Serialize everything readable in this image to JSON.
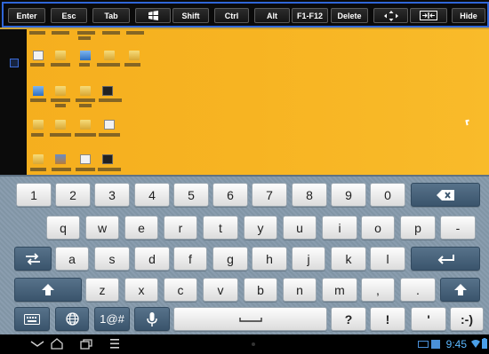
{
  "toolbar": {
    "keys": [
      {
        "label": "Enter"
      },
      {
        "label": "Esc"
      },
      {
        "label": "Tab"
      },
      {
        "icon": "windows-icon"
      },
      {
        "label": "Shift"
      },
      {
        "label": "Ctrl"
      },
      {
        "label": "Alt"
      },
      {
        "label": "F1-F12"
      },
      {
        "label": "Delete"
      },
      {
        "icon": "arrow-keys-icon"
      },
      {
        "icon": "fit-screen-icon"
      },
      {
        "label": "Hide"
      }
    ]
  },
  "desktop": {
    "background_color": "#f7b422"
  },
  "keyboard": {
    "number_row": [
      "1",
      "2",
      "3",
      "4",
      "5",
      "6",
      "7",
      "8",
      "9",
      "0"
    ],
    "row_q": [
      "q",
      "w",
      "e",
      "r",
      "t",
      "y",
      "u",
      "i",
      "o",
      "p",
      "-"
    ],
    "row_a": [
      "a",
      "s",
      "d",
      "f",
      "g",
      "h",
      "j",
      "k",
      "l"
    ],
    "row_z": [
      "z",
      "x",
      "c",
      "v",
      "b",
      "n",
      "m",
      ",",
      "."
    ],
    "bottom": {
      "symbols_label": "1@#",
      "question_label": "?",
      "exclaim_label": "!",
      "apostrophe_label": "'",
      "smiley_label": ":-)"
    },
    "icons": {
      "backspace": "backspace-icon",
      "switch": "switch-input-icon",
      "enter": "enter-icon",
      "shift": "shift-icon",
      "keyboard_settings": "keyboard-settings-icon",
      "language": "globe-icon",
      "voice": "microphone-icon",
      "space": "space-icon"
    },
    "key_color": "#f2f2f2",
    "function_key_color": "#4a6780"
  },
  "navbar": {
    "time": "9:45",
    "time_color": "#5bb8ff"
  }
}
